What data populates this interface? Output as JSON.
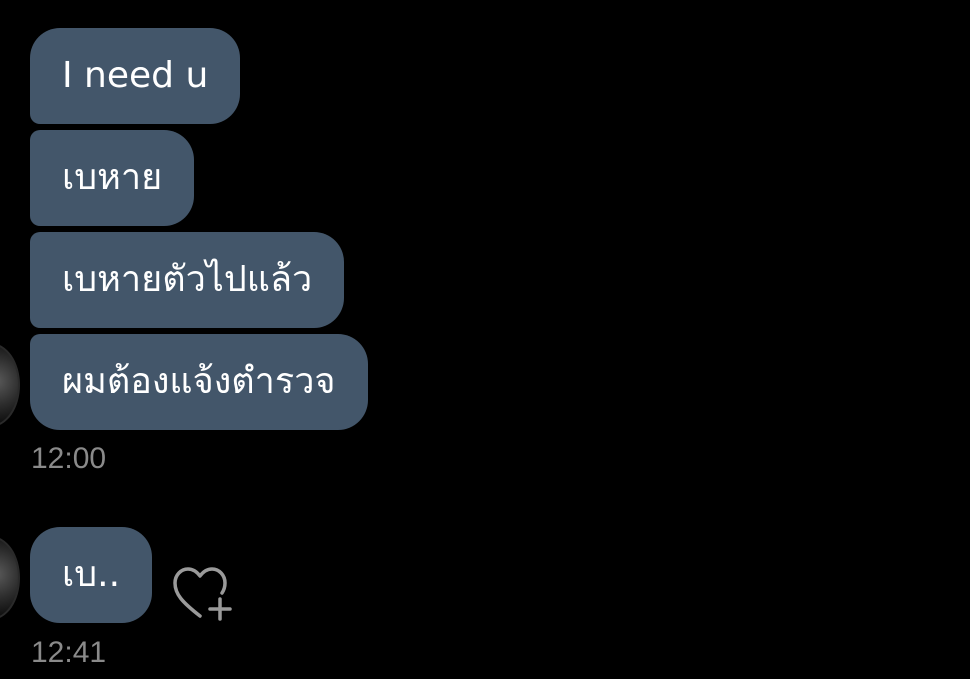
{
  "conversation": {
    "group1": {
      "messages": [
        {
          "text": "I need u"
        },
        {
          "text": "เบหาย"
        },
        {
          "text": "เบหายตัวไปแล้ว"
        },
        {
          "text": "ผมต้องแจ้งตำรวจ"
        }
      ],
      "time": "12:00"
    },
    "group2": {
      "messages": [
        {
          "text": "เบ.."
        }
      ],
      "time": "12:41"
    }
  },
  "icons": {
    "reaction": "heart-plus-icon",
    "avatar": "avatar"
  },
  "colors": {
    "background": "#000000",
    "bubble": "#43566a",
    "text": "#ffffff",
    "timestamp": "#8a8a8a",
    "icon": "#9a9a9a"
  }
}
